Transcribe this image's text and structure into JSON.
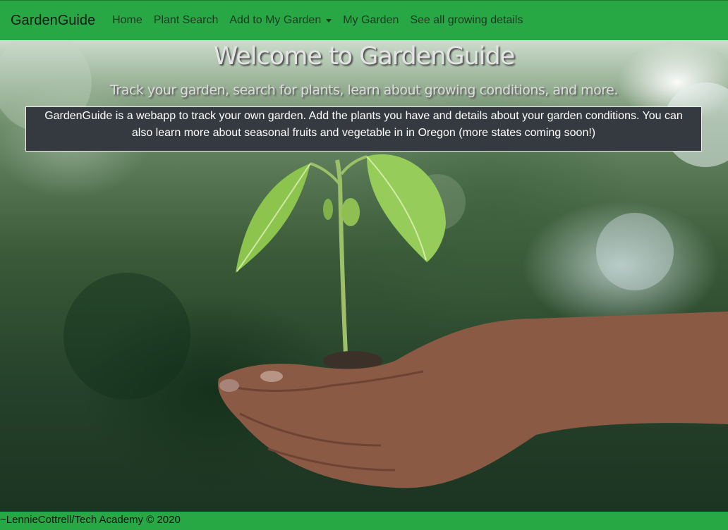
{
  "navbar": {
    "brand": "GardenGuide",
    "items": [
      {
        "label": "Home"
      },
      {
        "label": "Plant Search"
      },
      {
        "label": "Add to My Garden",
        "dropdown": true
      },
      {
        "label": "My Garden"
      },
      {
        "label": "See all growing details"
      }
    ]
  },
  "hero": {
    "title": "Welcome to GardenGuide",
    "subtitle": "Track your garden, search for plants, learn about growing conditions, and more.",
    "intro": "GardenGuide is a webapp to track your own garden. Add the plants you have and details about your garden conditions. You can also learn more about seasonal fruits and vegetable in in Oregon (more states coming soon!)",
    "image": "hand-holding-seedling"
  },
  "footer": {
    "text": "~LennieCottrell/Tech Academy © 2020"
  },
  "colors": {
    "navbar_bg": "#28a745",
    "intro_bg": "#343a40",
    "footer_bg": "#28a745"
  }
}
